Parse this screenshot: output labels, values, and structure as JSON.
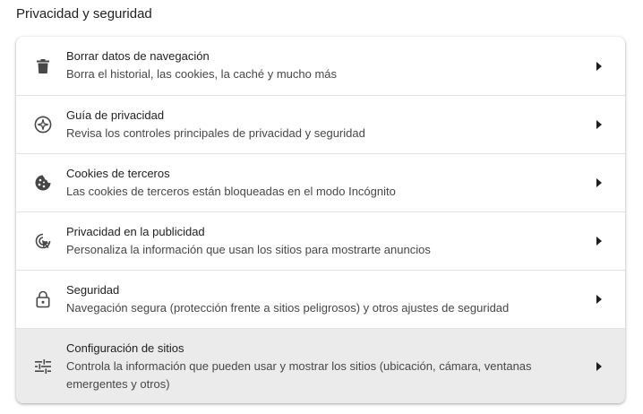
{
  "section": {
    "title": "Privacidad y seguridad"
  },
  "items": [
    {
      "icon": "trash-icon",
      "title": "Borrar datos de navegación",
      "subtitle": "Borra el historial, las cookies, la caché y mucho más"
    },
    {
      "icon": "privacy-guide-icon",
      "title": "Guía de privacidad",
      "subtitle": "Revisa los controles principales de privacidad y seguridad"
    },
    {
      "icon": "cookie-icon",
      "title": "Cookies de terceros",
      "subtitle": "Las cookies de terceros están bloqueadas en el modo Incógnito"
    },
    {
      "icon": "ad-privacy-icon",
      "title": "Privacidad en la publicidad",
      "subtitle": "Personaliza la información que usan los sitios para mostrarte anuncios"
    },
    {
      "icon": "lock-icon",
      "title": "Seguridad",
      "subtitle": "Navegación segura (protección frente a sitios peligrosos) y otros ajustes de seguridad"
    },
    {
      "icon": "tune-icon",
      "title": "Configuración de sitios",
      "subtitle": "Controla la información que pueden usar y mostrar los sitios (ubicación, cámara, ventanas emergentes y otros)"
    }
  ],
  "colors": {
    "icon": "#474747",
    "hover_row": "#ebebeb",
    "divider": "#e3e3e3"
  }
}
